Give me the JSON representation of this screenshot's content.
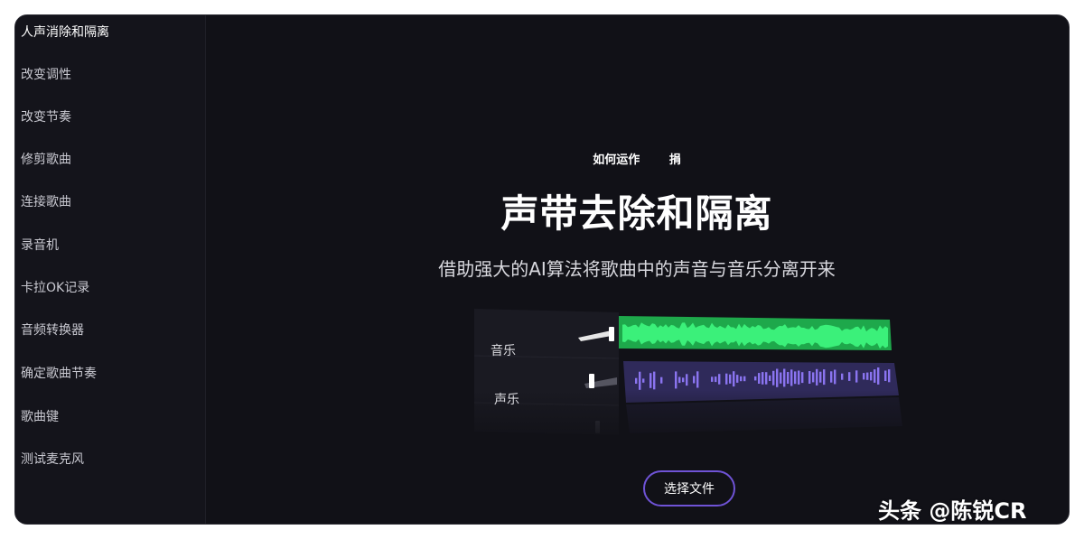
{
  "sidebar": {
    "items": [
      {
        "label": "人声消除和隔离"
      },
      {
        "label": "改变调性"
      },
      {
        "label": "改变节奏"
      },
      {
        "label": "修剪歌曲"
      },
      {
        "label": "连接歌曲"
      },
      {
        "label": "录音机"
      },
      {
        "label": "卡拉OK记录"
      },
      {
        "label": "音频转换器"
      },
      {
        "label": "确定歌曲节奏"
      },
      {
        "label": "歌曲键"
      },
      {
        "label": "测试麦克风"
      }
    ]
  },
  "main": {
    "links": [
      "如何运作",
      "捐"
    ],
    "title": "声带去除和隔离",
    "subtitle": "借助强大的AI算法将歌曲中的声音与音乐分离开来",
    "tracks": [
      {
        "label": "音乐",
        "color": "#2ee66b"
      },
      {
        "label": "声乐",
        "color": "#8a74f0"
      }
    ],
    "choose_label": "选择文件"
  },
  "watermark": "头条 @陈锐CR",
  "colors": {
    "background": "#111117",
    "accent": "#6f53d6",
    "music_wave": "#2ee66b",
    "vocal_wave": "#8a74f0"
  }
}
